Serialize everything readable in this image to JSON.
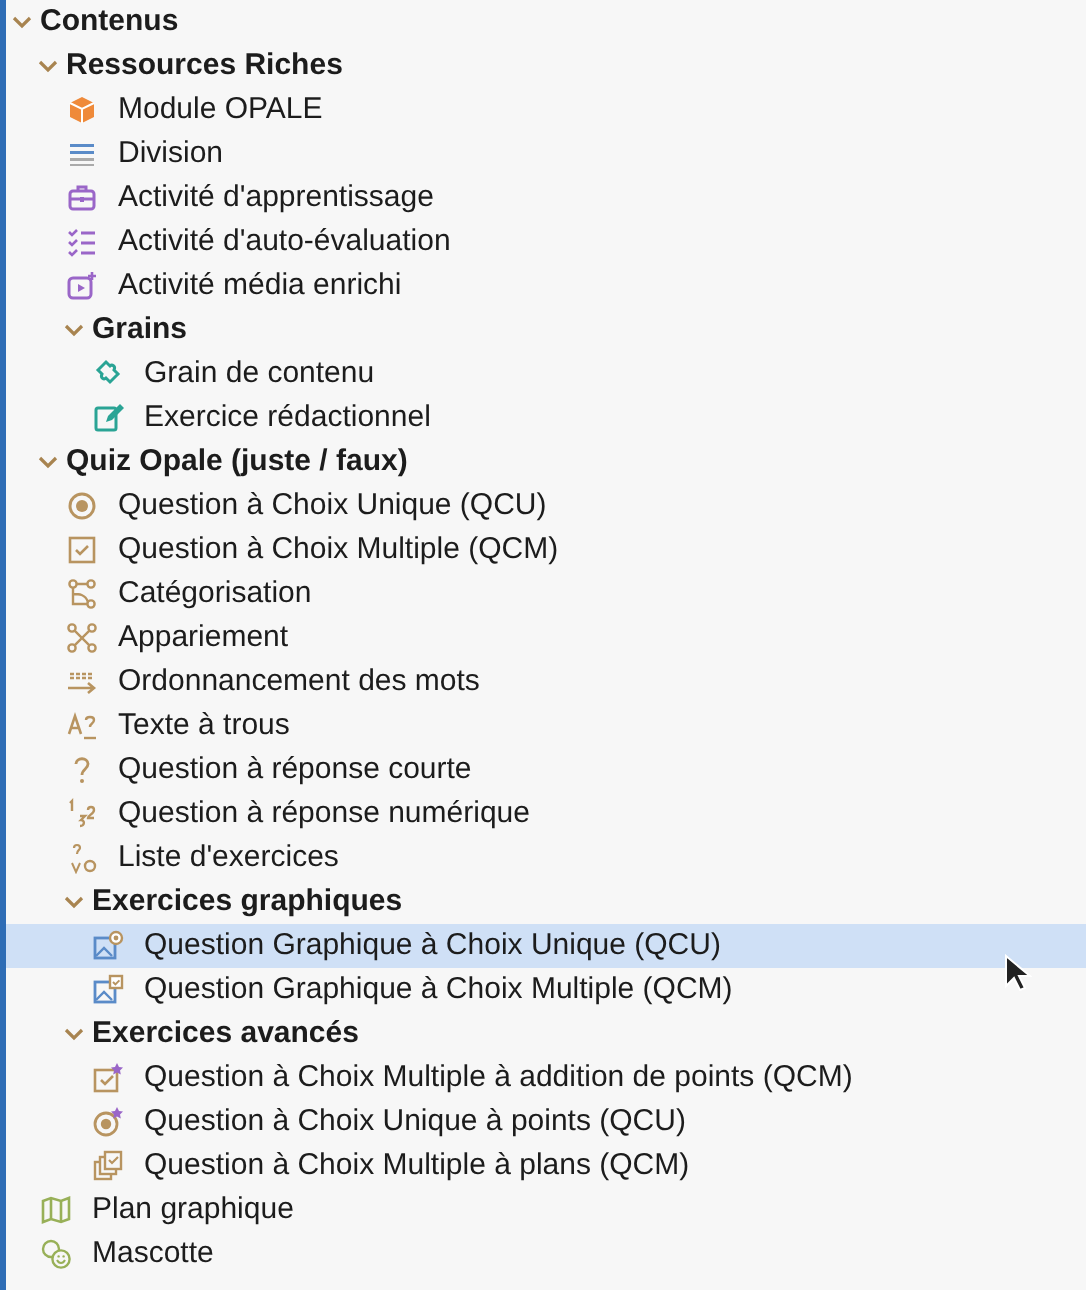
{
  "tree": [
    {
      "kind": "group",
      "label": "Contenus",
      "expanded": true,
      "selected": false,
      "children": [
        {
          "kind": "group",
          "label": "Ressources Riches",
          "expanded": true,
          "selected": false,
          "children": [
            {
              "kind": "item",
              "label": "Module OPALE",
              "selected": false
            },
            {
              "kind": "item",
              "label": "Division",
              "selected": false
            },
            {
              "kind": "item",
              "label": "Activité d'apprentissage",
              "selected": false
            },
            {
              "kind": "item",
              "label": "Activité d'auto-évaluation",
              "selected": false
            },
            {
              "kind": "item",
              "label": "Activité média enrichi",
              "selected": false
            },
            {
              "kind": "group",
              "label": "Grains",
              "expanded": true,
              "selected": false,
              "children": [
                {
                  "kind": "item",
                  "label": "Grain de contenu",
                  "selected": false
                },
                {
                  "kind": "item",
                  "label": "Exercice rédactionnel",
                  "selected": false
                }
              ]
            }
          ]
        },
        {
          "kind": "group",
          "label": "Quiz Opale (juste / faux)",
          "expanded": true,
          "selected": false,
          "children": [
            {
              "kind": "item",
              "label": "Question à Choix Unique (QCU)",
              "selected": false
            },
            {
              "kind": "item",
              "label": "Question à Choix Multiple (QCM)",
              "selected": false
            },
            {
              "kind": "item",
              "label": "Catégorisation",
              "selected": false
            },
            {
              "kind": "item",
              "label": "Appariement",
              "selected": false
            },
            {
              "kind": "item",
              "label": "Ordonnancement des mots",
              "selected": false
            },
            {
              "kind": "item",
              "label": "Texte à trous",
              "selected": false
            },
            {
              "kind": "item",
              "label": "Question à réponse courte",
              "selected": false
            },
            {
              "kind": "item",
              "label": "Question à réponse numérique",
              "selected": false
            },
            {
              "kind": "item",
              "label": "Liste d'exercices",
              "selected": false
            },
            {
              "kind": "group",
              "label": "Exercices graphiques",
              "expanded": true,
              "selected": false,
              "children": [
                {
                  "kind": "item",
                  "label": "Question Graphique à Choix Unique (QCU)",
                  "selected": true
                },
                {
                  "kind": "item",
                  "label": "Question Graphique à Choix Multiple (QCM)",
                  "selected": false
                }
              ]
            },
            {
              "kind": "group",
              "label": "Exercices avancés",
              "expanded": true,
              "selected": false,
              "children": [
                {
                  "kind": "item",
                  "label": "Question à Choix Multiple à addition de points (QCM)",
                  "selected": false
                },
                {
                  "kind": "item",
                  "label": "Question à Choix Unique à points (QCU)",
                  "selected": false
                },
                {
                  "kind": "item",
                  "label": "Question à Choix Multiple à plans (QCM)",
                  "selected": false
                }
              ]
            }
          ]
        },
        {
          "kind": "item",
          "label": "Plan graphique",
          "selected": false
        },
        {
          "kind": "item",
          "label": "Mascotte",
          "selected": false
        }
      ]
    }
  ]
}
